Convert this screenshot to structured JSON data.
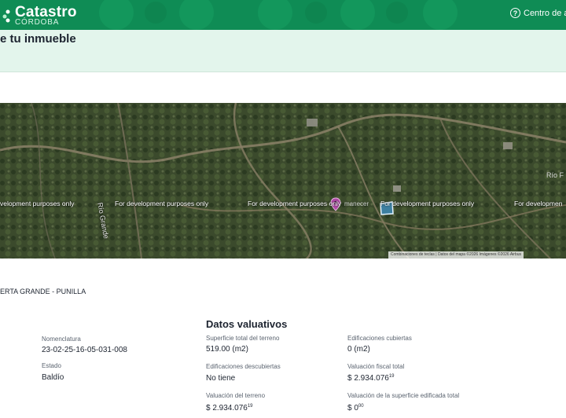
{
  "header": {
    "brand_title": "Catastro",
    "brand_subtitle": "CÓRDOBA",
    "help_label": "Centro de ay",
    "help_icon": "question-circle-icon",
    "color": "#0f8c55"
  },
  "page": {
    "title": "e tu inmueble"
  },
  "map": {
    "watermarks": [
      "velopment purposes only",
      "For development purposes only",
      "For development purposes only",
      "For development purposes only",
      "For developmen"
    ],
    "place_labels": [
      "Río Grande",
      "Río F",
      "manecer"
    ],
    "attribution": "Combinaciones de teclas  |  Datos del mapa ©2026 Imágenes ©2026 Airbus"
  },
  "location": "ERTA GRANDE - PUNILLA",
  "general": {
    "nomenclatura_label": "Nomenclatura",
    "nomenclatura_value": "23-02-25-16-05-031-008",
    "estado_label": "Estado",
    "estado_value": "Baldío"
  },
  "valuativos": {
    "title": "Datos valuativos",
    "superficie_label": "Superficie total del terreno",
    "superficie_value": "519.00 (m2)",
    "edif_cubiertas_label": "Edificaciones cubiertas",
    "edif_cubiertas_value": "0 (m2)",
    "edif_descubiertas_label": "Edificaciones descubiertas",
    "edif_descubiertas_value": "No tiene",
    "valuacion_fiscal_label": "Valuación fiscal total",
    "valuacion_fiscal_value": "$ 2.934.076",
    "valuacion_fiscal_cents": "19",
    "valuacion_terreno_label": "Valuación del terreno",
    "valuacion_terreno_value": "$ 2.934.076",
    "valuacion_terreno_cents": "19",
    "valuacion_edificada_label": "Valuación de la superficie edificada total",
    "valuacion_edificada_value": "$ 0",
    "valuacion_edificada_cents": "00"
  }
}
